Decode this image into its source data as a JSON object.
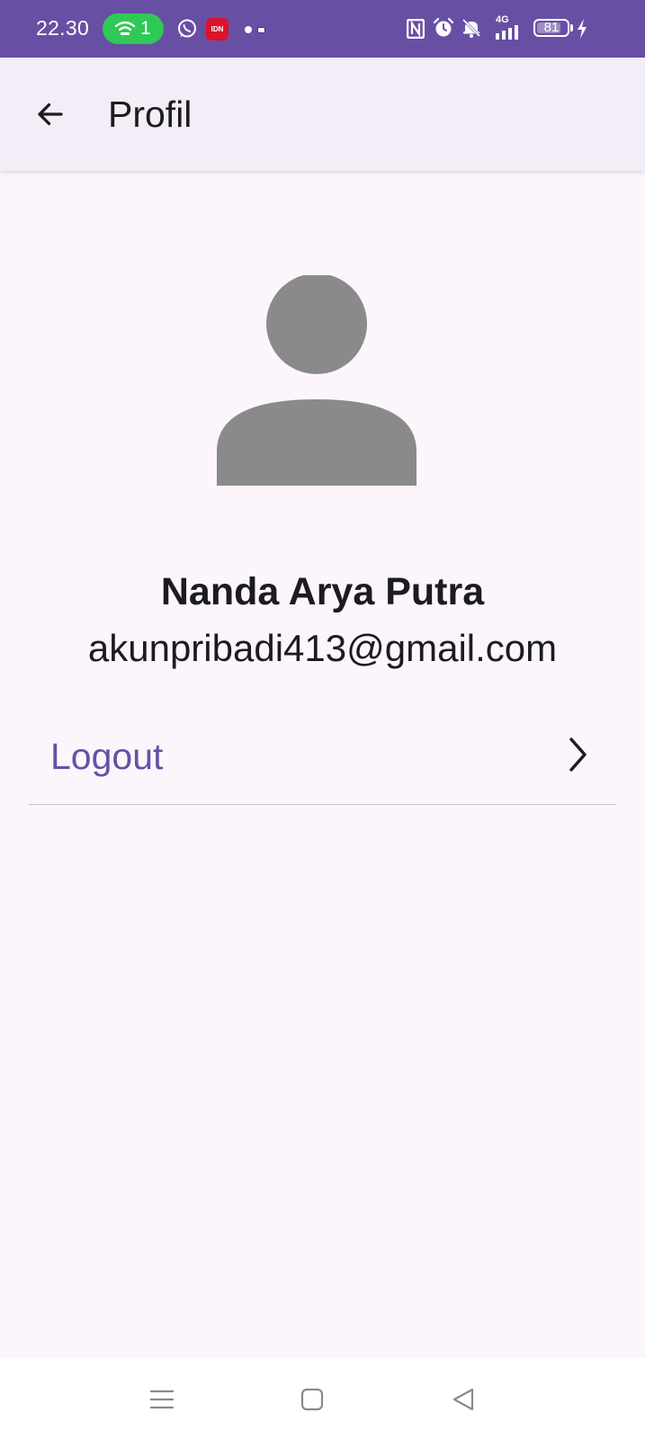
{
  "status_bar": {
    "time": "22.30",
    "hotspot_count": "1",
    "idn_badge": "IDN",
    "network": "4G",
    "battery": "81",
    "battery_level": 0.81,
    "icons": [
      "hotspot-icon",
      "whatsapp-icon",
      "idn-app-icon",
      "nfc-icon",
      "alarm-icon",
      "silent-icon",
      "signal-icon",
      "battery-icon",
      "charging-icon"
    ],
    "colors": {
      "background": "#6750a4",
      "hotspot": "#2fc955",
      "idn": "#d9142b"
    }
  },
  "app_bar": {
    "title": "Profil",
    "back_icon": "arrow-back-icon"
  },
  "profile": {
    "avatar_icon": "person-icon",
    "name": "Nanda Arya Putra",
    "email": "akunpribadi413@gmail.com"
  },
  "menu": {
    "logout_label": "Logout",
    "logout_icon": "chevron-right-icon",
    "accent_color": "#6750a4"
  },
  "nav_bar": {
    "items": [
      "menu-icon",
      "home-icon",
      "back-icon"
    ]
  }
}
